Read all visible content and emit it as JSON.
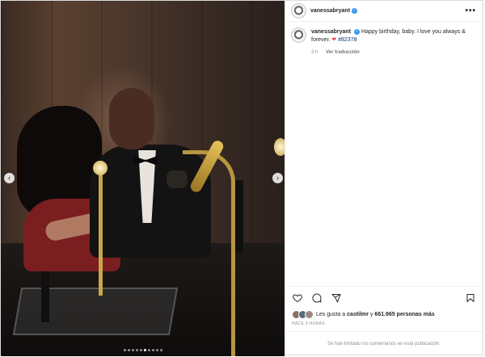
{
  "post": {
    "username": "vanessabryant",
    "verified_mark": "✓",
    "more_label": "•••",
    "media": {
      "prev_arrow": "‹",
      "next_arrow": "›",
      "carousel_count": 10,
      "carousel_active_index": 5
    },
    "caption": {
      "username": "vanessabryant",
      "text": "Happy birthday, baby. I love you always & forever.",
      "heart": "❤",
      "hashtag": "#82378",
      "time_ago": "3 h",
      "translate_label": "Ver traducción"
    },
    "actions": [
      "heart-icon",
      "comment-icon",
      "share-icon",
      "bookmark-icon"
    ],
    "likes": {
      "prefix": "Les gusta a",
      "liker": "castilmr",
      "connector": "y",
      "count": "661.965 personas más",
      "avatar_colors": [
        "#8d6e63",
        "#546e7a",
        "#a1887f"
      ]
    },
    "timestamp": "HACE 3 HORAS",
    "comments_limited": "Se han limitado los comentarios en esta publicación."
  }
}
